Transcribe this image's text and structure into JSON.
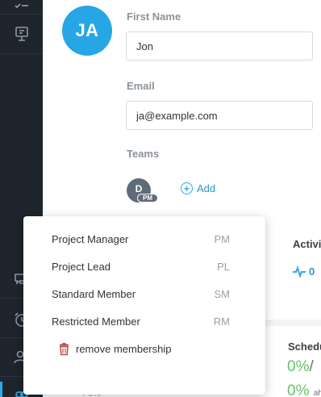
{
  "profile": {
    "initials": "JA",
    "avatar_color": "#27a6e6",
    "first_name_label": "First Name",
    "first_name_value": "Jon",
    "email_label": "Email",
    "email_value": "ja@example.com",
    "teams_label": "Teams",
    "team_chip_letter": "D",
    "team_chip_role": "PM",
    "add_label": "Add"
  },
  "role_menu": {
    "items": [
      {
        "label": "Project Manager",
        "abbr": "PM"
      },
      {
        "label": "Project Lead",
        "abbr": "PL"
      },
      {
        "label": "Standard Member",
        "abbr": "SM"
      },
      {
        "label": "Restricted Member",
        "abbr": "RM"
      }
    ],
    "remove_label": "remove membership"
  },
  "background": {
    "activity_title": "Activi",
    "activity_value": "0",
    "schedule_title": "Schedu",
    "schedule_pct": "0%",
    "schedule_slash": "/",
    "schedule_pct_2": "0%",
    "schedule_small": "ah",
    "behind_text": "/ 0%"
  },
  "colors": {
    "sidebar": "#1e252d",
    "accent": "#2ea9e6",
    "green": "#69c06a",
    "remove_icon": "#b94a48"
  },
  "sidebar_icons": [
    "checklist-icon",
    "presentation-icon",
    "chat-icon",
    "alarm-clock-icon",
    "users-icon",
    "link-icon"
  ]
}
